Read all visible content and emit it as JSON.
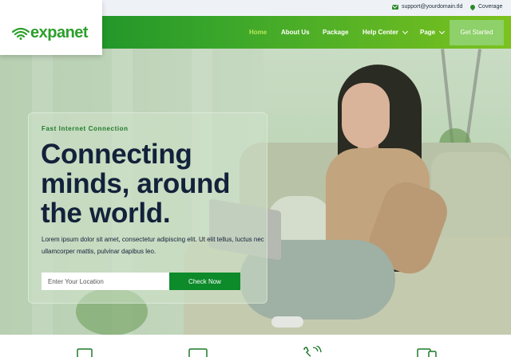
{
  "topbar": {
    "email": "support@yourdomain.tld",
    "coverage": "Coverage",
    "email_icon": "envelope-icon",
    "coverage_icon": "map-pin-icon"
  },
  "brand": {
    "name": "expanet",
    "icon": "wifi-signal-icon",
    "color": "#2c9f2c"
  },
  "nav": {
    "items": [
      {
        "label": "Home",
        "active": true
      },
      {
        "label": "About Us"
      },
      {
        "label": "Package"
      },
      {
        "label": "Help Center",
        "dropdown": true
      },
      {
        "label": "Page",
        "dropdown": true
      }
    ],
    "cta": "Get Started",
    "gradient": [
      "#0f8a2a",
      "#7cc21e"
    ]
  },
  "hero": {
    "eyebrow": "Fast Internet Connection",
    "headline": "Connecting minds, around the world.",
    "lead": "Lorem ipsum dolor sit amet, consectetur adipiscing elit. Ut elit tellus, luctus nec ullamcorper mattis, pulvinar dapibus leo.",
    "location_placeholder": "Enter Your Location",
    "check_button": "Check Now",
    "accent": "#0d8a2a"
  },
  "features": {
    "icons": [
      "monitor-icon",
      "monitor-icon",
      "phone-call-icon",
      "mobile-devices-icon"
    ]
  }
}
